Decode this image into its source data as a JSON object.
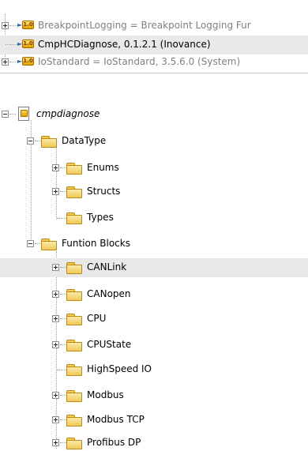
{
  "libraries": [
    {
      "label": "BreakpointLogging = Breakpoint Logging Fur",
      "badge": "1.0",
      "greyed": true
    },
    {
      "label": "CmpHCDiagnose, 0.1.2.1 (Inovance)",
      "badge": "1.0",
      "greyed": false
    },
    {
      "label": "IoStandard = IoStandard, 3.5.6.0 (System)",
      "badge": "1.0",
      "greyed": true
    }
  ],
  "tree": {
    "root": "cmpdiagnose",
    "datatype": {
      "label": "DataType",
      "children": [
        "Enums",
        "Structs",
        "Types"
      ]
    },
    "function_blocks": {
      "label": "Funtion Blocks",
      "children": [
        "CANLink",
        "CANopen",
        "CPU",
        "CPUState",
        "HighSpeed IO",
        "Modbus",
        "Modbus TCP",
        "Profibus DP"
      ]
    }
  }
}
